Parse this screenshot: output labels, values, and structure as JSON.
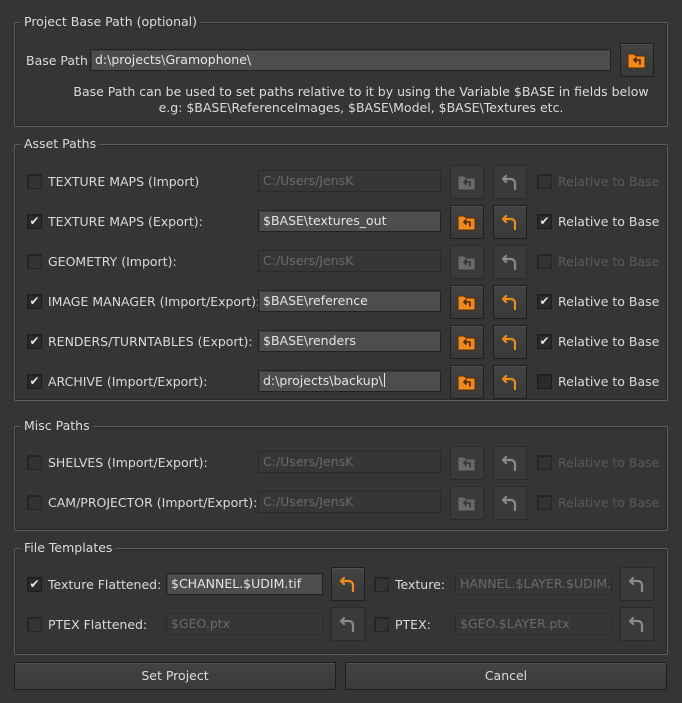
{
  "project_base": {
    "title": "Project Base Path (optional)",
    "base_path_label": "Base Path",
    "base_path_value": "d:\\projects\\Gramophone\\",
    "browse_icon": "folder-open-arrow-icon",
    "note_line1": "Base Path can be used to set paths relative to it by using the Variable $BASE in fields below",
    "note_line2": "e.g: $BASE\\ReferenceImages, $BASE\\Model, $BASE\\Textures etc."
  },
  "asset_paths": {
    "title": "Asset Paths",
    "rows": [
      {
        "label": "TEXTURE MAPS (Import)",
        "checked": false,
        "path": "C:/Users/JensK",
        "enabled": false,
        "relative_label": "Relative to Base",
        "relative_checked": false
      },
      {
        "label": "TEXTURE MAPS (Export):",
        "checked": true,
        "path": "$BASE\\textures_out",
        "enabled": true,
        "relative_label": "Relative to Base",
        "relative_checked": true
      },
      {
        "label": "GEOMETRY (Import):",
        "checked": false,
        "path": "C:/Users/JensK",
        "enabled": false,
        "relative_label": "Relative to Base",
        "relative_checked": false
      },
      {
        "label": "IMAGE MANAGER (Import/Export):",
        "checked": true,
        "path": "$BASE\\reference",
        "enabled": true,
        "relative_label": "Relative to Base",
        "relative_checked": true
      },
      {
        "label": "RENDERS/TURNTABLES (Export):",
        "checked": true,
        "path": "$BASE\\renders",
        "enabled": true,
        "relative_label": "Relative to Base",
        "relative_checked": true
      },
      {
        "label": "ARCHIVE (Import/Export):",
        "checked": true,
        "path": "d:\\projects\\backup\\",
        "enabled": true,
        "relative_label": "Relative to Base",
        "relative_checked": false
      }
    ]
  },
  "misc_paths": {
    "title": "Misc Paths",
    "rows": [
      {
        "label": "SHELVES (Import/Export):",
        "checked": false,
        "path": "C:/Users/JensK",
        "enabled": false,
        "relative_label": "Relative to Base",
        "relative_checked": false
      },
      {
        "label": "CAM/PROJECTOR (Import/Export):",
        "checked": false,
        "path": "C:/Users/JensK",
        "enabled": false,
        "relative_label": "Relative to Base",
        "relative_checked": false
      }
    ]
  },
  "file_templates": {
    "title": "File Templates",
    "texture_flattened_label": "Texture Flattened:",
    "texture_flattened_checked": true,
    "texture_flattened_value": "$CHANNEL.$UDIM.tif",
    "texture_label": "Texture:",
    "texture_checked": false,
    "texture_value": "HANNEL.$LAYER.$UDIM.tif",
    "ptex_flattened_label": "PTEX Flattened:",
    "ptex_flattened_checked": false,
    "ptex_flattened_value": "$GEO.ptx",
    "ptex_label": "PTEX:",
    "ptex_checked": false,
    "ptex_value": "$GEO.$LAYER.ptx"
  },
  "buttons": {
    "set_project": "Set Project",
    "cancel": "Cancel"
  },
  "icons": {
    "browse": "folder-open-arrow-icon",
    "reset": "undo-arrow-icon",
    "check": "checkmark-icon"
  },
  "colors": {
    "accent_orange": "#f08a1e",
    "background": "#353535",
    "field": "#4d4d4d"
  }
}
